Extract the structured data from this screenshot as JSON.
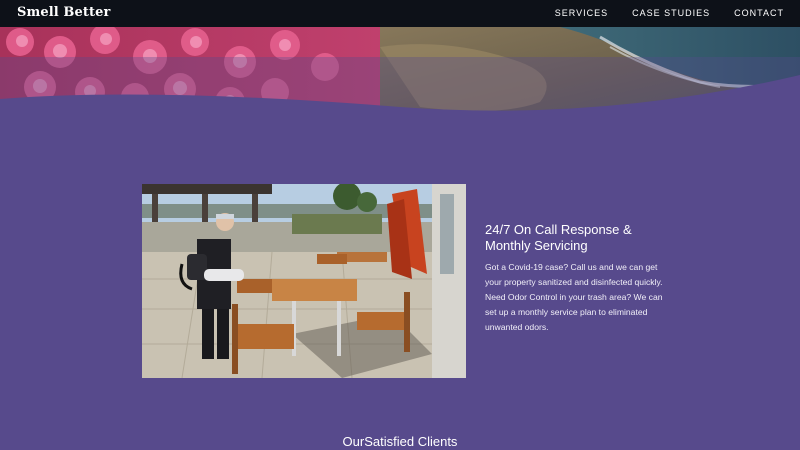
{
  "brand": {
    "logo_text": "Smell Better"
  },
  "nav": {
    "items": [
      {
        "label": "SERVICES"
      },
      {
        "label": "CASE STUDIES"
      },
      {
        "label": "CONTACT"
      }
    ]
  },
  "service": {
    "title": "24/7 On Call Response & Monthly Servicing",
    "body": "Got a Covid-19 case? Call us and we can get your property sanitized and disinfected quickly. Need Odor Control in your trash area? We can set up a monthly service plan to eliminated unwanted odors."
  },
  "clients": {
    "heading": "OurSatisfied Clients"
  },
  "colors": {
    "background": "#574a8c",
    "navbar": "#0d1118",
    "text": "#ffffff"
  }
}
